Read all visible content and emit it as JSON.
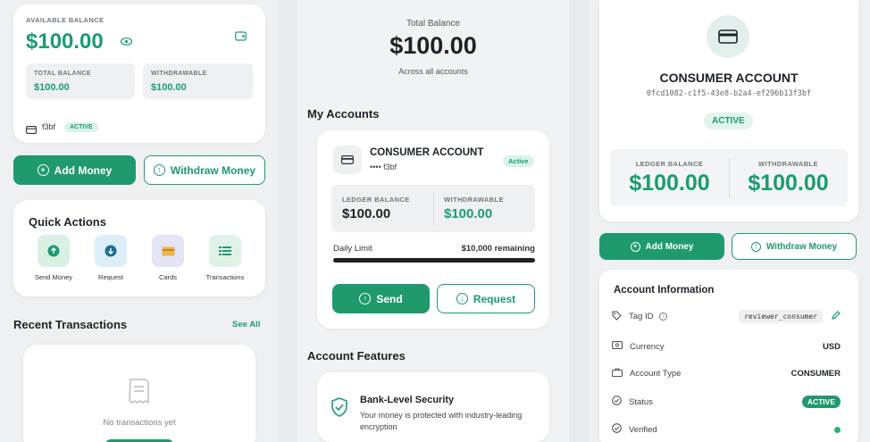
{
  "left": {
    "balance_card": {
      "label": "AVAILABLE BALANCE",
      "amount": "$100.00",
      "total_label": "TOTAL BALANCE",
      "total_value": "$100.00",
      "withdrawable_label": "WITHDRAWABLE",
      "withdrawable_value": "$100.00",
      "account_suffix": "f3bf",
      "status": "ACTIVE"
    },
    "add_money": "Add Money",
    "withdraw_money": "Withdraw Money",
    "quick_actions": {
      "title": "Quick Actions",
      "items": [
        {
          "label": "Send Money",
          "icon": "arrow-up-icon"
        },
        {
          "label": "Request",
          "icon": "arrow-down-icon"
        },
        {
          "label": "Cards",
          "icon": "card-icon"
        },
        {
          "label": "Transactions",
          "icon": "list-icon"
        }
      ]
    },
    "recent": {
      "title": "Recent Transactions",
      "see_all": "See All",
      "empty": "No transactions yet"
    }
  },
  "middle": {
    "total_label": "Total Balance",
    "total_amount": "$100.00",
    "total_sub": "Across all accounts",
    "my_accounts_title": "My Accounts",
    "account": {
      "name": "CONSUMER ACCOUNT",
      "masked": "•••• f3bf",
      "status": "Active",
      "ledger_label": "LEDGER BALANCE",
      "ledger_value": "$100.00",
      "withdrawable_label": "WITHDRAWABLE",
      "withdrawable_value": "$100.00",
      "daily_limit_label": "Daily Limit",
      "daily_limit_value": "$10,000 remaining",
      "send": "Send",
      "request": "Request"
    },
    "features_title": "Account Features",
    "feature": {
      "title": "Bank-Level Security",
      "desc": "Your money is protected with industry-leading encryption"
    }
  },
  "right": {
    "account_name": "CONSUMER ACCOUNT",
    "account_id": "0fcd1082-c1f5-43e8-b2a4-ef296b13f3bf",
    "status": "ACTIVE",
    "ledger_label": "LEDGER BALANCE",
    "ledger_value": "$100.00",
    "withdrawable_label": "WITHDRAWABLE",
    "withdrawable_value": "$100.00",
    "add_money": "Add Money",
    "withdraw_money": "Withdraw Money",
    "info": {
      "title": "Account Information",
      "tag_label": "Tag ID",
      "tag_value": "reviewer_consumer",
      "currency_label": "Currency",
      "currency_value": "USD",
      "type_label": "Account Type",
      "type_value": "CONSUMER",
      "status_label": "Status",
      "status_value": "ACTIVE",
      "verified_label": "Verified"
    }
  },
  "colors": {
    "accent": "#1f9a6d",
    "accent_light": "#d9f3e7"
  }
}
